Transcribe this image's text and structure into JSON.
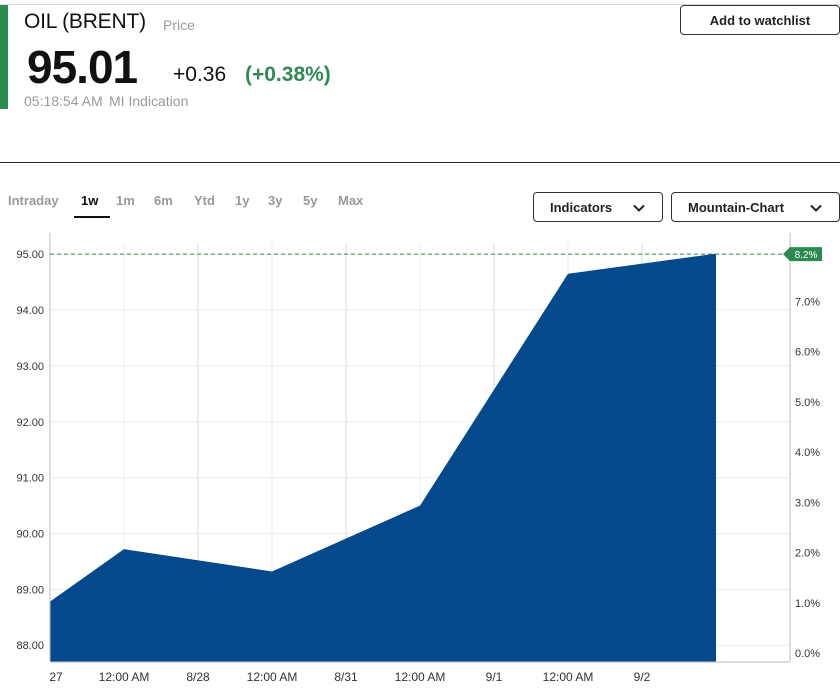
{
  "header": {
    "name": "OIL (BRENT)",
    "type": "Price",
    "price": "95.01",
    "change_abs": "+0.36",
    "change_pct": "(+0.38%)",
    "timestamp": "05:18:54 AM",
    "indication": "MI Indication",
    "watchlist_label": "Add to watchlist"
  },
  "colors": {
    "accent": "#2b8a4e",
    "positive": "#2f8a55",
    "area_fill": "#04498b",
    "badge": "#2b8a4e"
  },
  "tabs": [
    {
      "label": "Intraday",
      "active": false
    },
    {
      "label": "1w",
      "active": true
    },
    {
      "label": "1m",
      "active": false
    },
    {
      "label": "6m",
      "active": false
    },
    {
      "label": "Ytd",
      "active": false
    },
    {
      "label": "1y",
      "active": false
    },
    {
      "label": "3y",
      "active": false
    },
    {
      "label": "5y",
      "active": false
    },
    {
      "label": "Max",
      "active": false
    }
  ],
  "controls": {
    "indicators_label": "Indicators",
    "chart_type_label": "Mountain-Chart",
    "chevron_icon": "chevron-down-icon"
  },
  "chart_data": {
    "type": "area",
    "x_tick_labels": [
      "27",
      "12:00 AM",
      "8/28",
      "12:00 AM",
      "8/31",
      "12:00 AM",
      "9/1",
      "12:00 AM",
      "9/2"
    ],
    "y_left_ticks": [
      "95.00",
      "94.00",
      "93.00",
      "92.00",
      "91.00",
      "90.00",
      "89.00",
      "88.00"
    ],
    "y_right_ticks": [
      "8.0%",
      "7.0%",
      "6.0%",
      "5.0%",
      "4.0%",
      "3.0%",
      "2.0%",
      "1.0%",
      "0.0%"
    ],
    "ylim": [
      87.7,
      95.2
    ],
    "x_range": [
      0,
      9
    ],
    "series": [
      {
        "values": [
          {
            "x": 0,
            "y": 88.78
          },
          {
            "x": 1,
            "y": 89.72
          },
          {
            "x": 3,
            "y": 89.32
          },
          {
            "x": 5,
            "y": 90.5
          },
          {
            "x": 7,
            "y": 94.65
          },
          {
            "x": 9,
            "y": 95.01
          }
        ]
      }
    ],
    "current_value": 95.0,
    "current_pct_badge": "8.2%",
    "grid": true
  }
}
